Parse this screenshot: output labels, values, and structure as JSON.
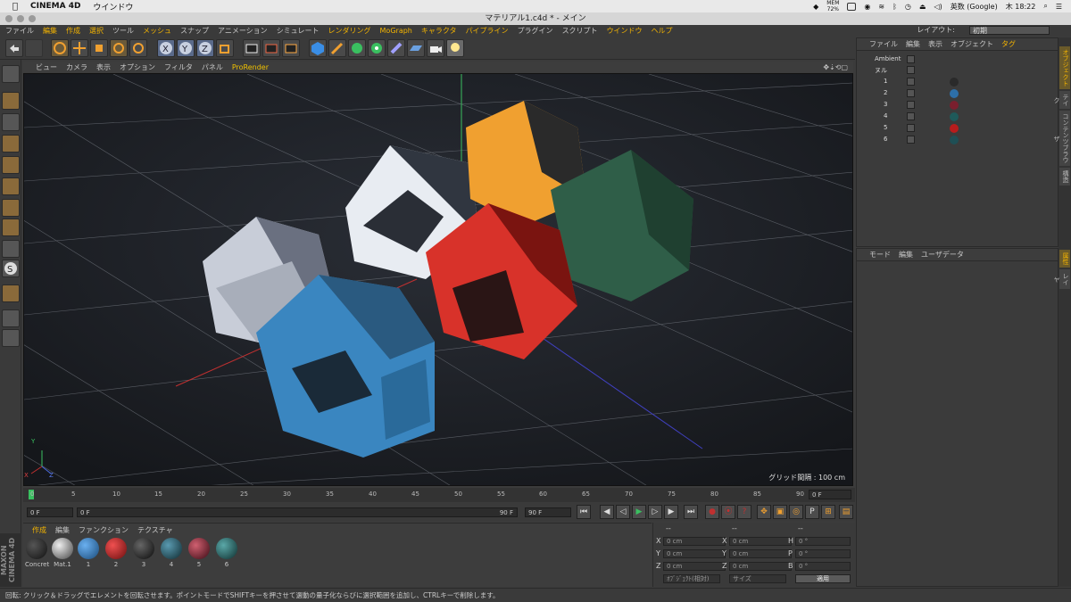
{
  "macbar": {
    "app_name": "CINEMA 4D",
    "menu_window": "ウインドウ",
    "mem_label": "MEM",
    "mem_value": "72%",
    "input_method": "英数 (Google)",
    "clock": "木 18:22"
  },
  "window": {
    "title": "マテリアル1.c4d * - メイン"
  },
  "mainmenu": {
    "items": [
      "ファイル",
      "編集",
      "作成",
      "選択",
      "ツール",
      "メッシュ",
      "スナップ",
      "アニメーション",
      "シミュレート",
      "レンダリング",
      "MoGraph",
      "キャラクタ",
      "パイプライン",
      "プラグイン",
      "スクリプト",
      "ウインドウ",
      "ヘルプ"
    ],
    "layout_label": "レイアウト:",
    "layout_value": "初期"
  },
  "viewport": {
    "menu": [
      "ビュー",
      "カメラ",
      "表示",
      "オプション",
      "フィルタ",
      "パネル",
      "ProRender"
    ],
    "grid_label": "グリッド間隔 : 100 cm",
    "axis_x": "X",
    "axis_y": "Y",
    "axis_z": "Z"
  },
  "timeline": {
    "ticks": [
      "0",
      "5",
      "10",
      "15",
      "20",
      "25",
      "30",
      "35",
      "40",
      "45",
      "50",
      "55",
      "60",
      "65",
      "70",
      "75",
      "80",
      "85",
      "90"
    ],
    "end_field": "0 F",
    "start_field": "0 F",
    "range_start": "0 F",
    "range_end": "90 F",
    "end_frame": "90 F"
  },
  "materials": {
    "menu": [
      "作成",
      "編集",
      "ファンクション",
      "テクスチャ"
    ],
    "items": [
      {
        "label": "Concret",
        "color": "#1a1a1a"
      },
      {
        "label": "Mat.1",
        "color": "#9a9a9a"
      },
      {
        "label": "1",
        "color": "#2d6fa8"
      },
      {
        "label": "2",
        "color": "#b81c1c"
      },
      {
        "label": "3",
        "color": "#1c1c1c"
      },
      {
        "label": "4",
        "color": "#1f4f55"
      },
      {
        "label": "5",
        "color": "#7a1f2e"
      },
      {
        "label": "6",
        "color": "#1f5a5a"
      }
    ]
  },
  "coords": {
    "header": [
      "--",
      "--",
      "--"
    ],
    "rows": [
      {
        "a": "X",
        "av": "0 cm",
        "b": "X",
        "bv": "0 cm",
        "c": "H",
        "cv": "0 °"
      },
      {
        "a": "Y",
        "av": "0 cm",
        "b": "Y",
        "bv": "0 cm",
        "c": "P",
        "cv": "0 °"
      },
      {
        "a": "Z",
        "av": "0 cm",
        "b": "Z",
        "bv": "0 cm",
        "c": "B",
        "cv": "0 °"
      }
    ],
    "mode_select": "ｵﾌﾞｼﾞｪｸﾄ(相対)",
    "size_select": "サイズ",
    "apply": "適用"
  },
  "objects": {
    "menu": [
      "ファイル",
      "編集",
      "表示",
      "オブジェクト",
      "タグ"
    ],
    "rows": [
      {
        "name": "Ambient",
        "tag": ""
      },
      {
        "name": "ヌル",
        "tag": ""
      },
      {
        "name": "1",
        "tag": "#2a2a2a"
      },
      {
        "name": "2",
        "tag": "#2d6fa8"
      },
      {
        "name": "3",
        "tag": "#7a1f2e"
      },
      {
        "name": "4",
        "tag": "#1f5a5a"
      },
      {
        "name": "5",
        "tag": "#b81c1c"
      },
      {
        "name": "6",
        "tag": "#1f4f55"
      }
    ]
  },
  "attributes": {
    "menu": [
      "モード",
      "編集",
      "ユーザデータ"
    ]
  },
  "sidetabs": [
    "オブジェクト",
    "テイク",
    "コンテンツブラウザ",
    "構造",
    "属性",
    "レイヤ"
  ],
  "maxon": "MAXON CINEMA 4D",
  "status": "回転: クリック＆ドラッグでエレメントを回転させます。ポイントモードでSHIFTキーを押させて選動の量子化ならびに選択範囲を追加し、CTRLキーで削除します。",
  "colors": {
    "accent": "#f4b400",
    "viewport_bg": "#1e2126"
  }
}
